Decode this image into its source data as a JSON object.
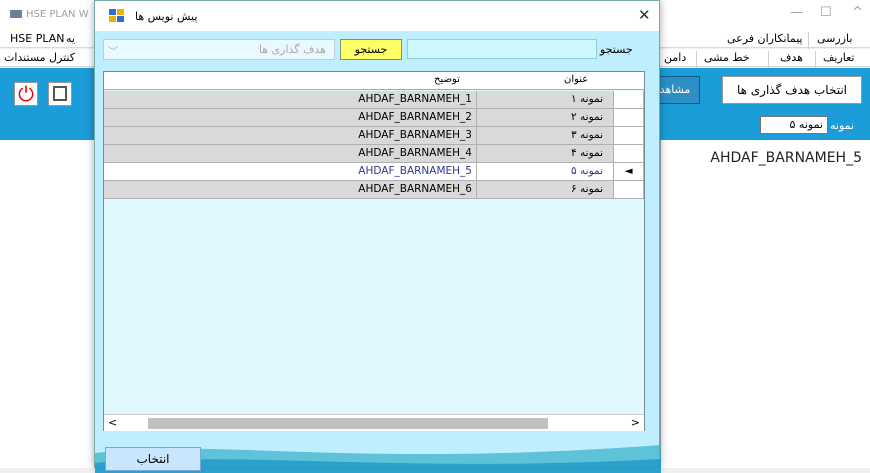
{
  "main": {
    "title": "HSE PLAN W",
    "minimize": "—",
    "maximize": "☐",
    "close": "^",
    "menu1": [
      "HSE PLAN",
      "یه",
      "پیمانکاران فرعی",
      "بازرسی"
    ],
    "menu2": [
      "کنترل مستندات",
      "دامن",
      "خط مشی",
      "هدف",
      "تعاریف"
    ],
    "select_goals_label": "انتخاب هدف گذاری ها",
    "view_label": "مشاهد",
    "name_label": "نمونه",
    "name_value": "نمونه ۵",
    "right_panel_value": "AHDAF_BARNAMEH_5"
  },
  "dialog": {
    "title": "پیش نویس ها",
    "close": "✕",
    "search_label": "جستجو",
    "search_value": "",
    "search_button": "جستجو",
    "select_placeholder": "هدف گذاری ها",
    "select_button": "انتخاب",
    "grid": {
      "col_desc": "توضیح",
      "col_title": "عنوان",
      "rows": [
        {
          "desc": "AHDAF_BARNAMEH_1",
          "title": "نمونه ۱"
        },
        {
          "desc": "AHDAF_BARNAMEH_2",
          "title": "نمونه ۲"
        },
        {
          "desc": "AHDAF_BARNAMEH_3",
          "title": "نمونه ۳"
        },
        {
          "desc": "AHDAF_BARNAMEH_4",
          "title": "نمونه ۴"
        },
        {
          "desc": "AHDAF_BARNAMEH_5",
          "title": "نمونه ۵"
        },
        {
          "desc": "AHDAF_BARNAMEH_6",
          "title": "نمونه ۶"
        }
      ],
      "selected_index": 4,
      "selected_marker": "◄"
    }
  }
}
